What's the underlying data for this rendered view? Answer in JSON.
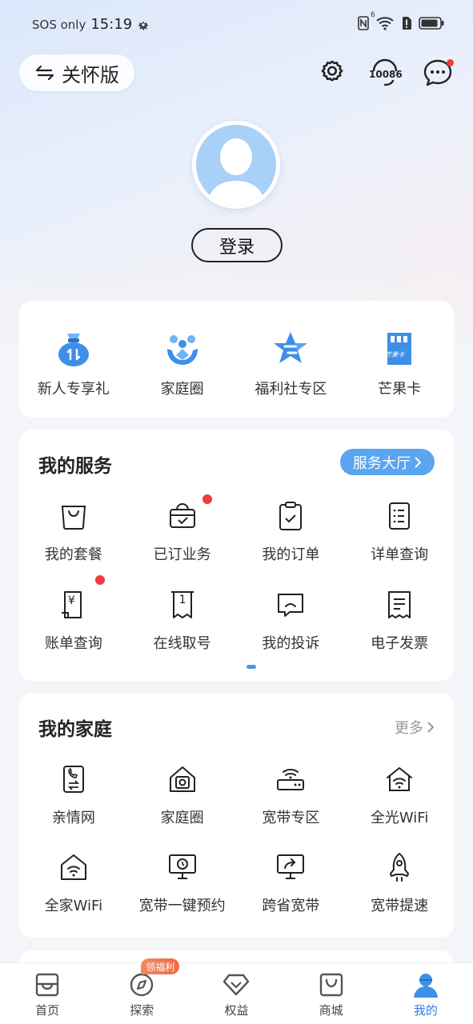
{
  "status_bar": {
    "carrier": "SOS only",
    "time": "15:19",
    "signal_label": "6"
  },
  "header": {
    "care_mode_label": "关怀版",
    "hotline_label": "10086"
  },
  "profile": {
    "login_label": "登录"
  },
  "quick_actions": [
    {
      "label": "新人专享礼",
      "icon": "gift-bag-icon"
    },
    {
      "label": "家庭圈",
      "icon": "family-icon"
    },
    {
      "label": "福利社专区",
      "icon": "star-icon"
    },
    {
      "label": "芒果卡",
      "icon": "sim-card-icon",
      "card_text": "芒果卡"
    }
  ],
  "my_services": {
    "title": "我的服务",
    "hall_label": "服务大厅",
    "items": [
      {
        "label": "我的套餐",
        "icon": "shopping-bag-icon",
        "dot": false
      },
      {
        "label": "已订业务",
        "icon": "basket-check-icon",
        "dot": true
      },
      {
        "label": "我的订单",
        "icon": "clipboard-check-icon",
        "dot": false
      },
      {
        "label": "详单查询",
        "icon": "list-doc-icon",
        "dot": false
      },
      {
        "label": "账单查询",
        "icon": "bill-yen-icon",
        "dot": true,
        "yen": "¥"
      },
      {
        "label": "在线取号",
        "icon": "ticket-number-icon",
        "dot": false,
        "num": "1"
      },
      {
        "label": "我的投诉",
        "icon": "complaint-chat-icon",
        "dot": false
      },
      {
        "label": "电子发票",
        "icon": "invoice-icon",
        "dot": false
      }
    ]
  },
  "my_family": {
    "title": "我的家庭",
    "more_label": "更多",
    "items": [
      {
        "label": "亲情网",
        "icon": "family-phone-icon"
      },
      {
        "label": "家庭圈",
        "icon": "home-camera-icon"
      },
      {
        "label": "宽带专区",
        "icon": "router-icon"
      },
      {
        "label": "全光WiFi",
        "icon": "home-wifi-icon"
      },
      {
        "label": "全家WiFi",
        "icon": "house-wifi-icon"
      },
      {
        "label": "宽带一键预约",
        "icon": "monitor-clock-icon"
      },
      {
        "label": "跨省宽带",
        "icon": "monitor-share-icon"
      },
      {
        "label": "宽带提速",
        "icon": "rocket-icon"
      }
    ]
  },
  "bottom_nav": {
    "items": [
      {
        "label": "首页",
        "icon": "home-tab-icon"
      },
      {
        "label": "探索",
        "icon": "compass-icon",
        "badge": "领福利"
      },
      {
        "label": "权益",
        "icon": "diamond-icon"
      },
      {
        "label": "商城",
        "icon": "shop-bag-icon"
      },
      {
        "label": "我的",
        "icon": "user-tab-icon",
        "active": true
      }
    ]
  },
  "colors": {
    "accent": "#2b7de9",
    "hall_button": "#5aa5f0",
    "red_dot": "#ee3b3b"
  }
}
